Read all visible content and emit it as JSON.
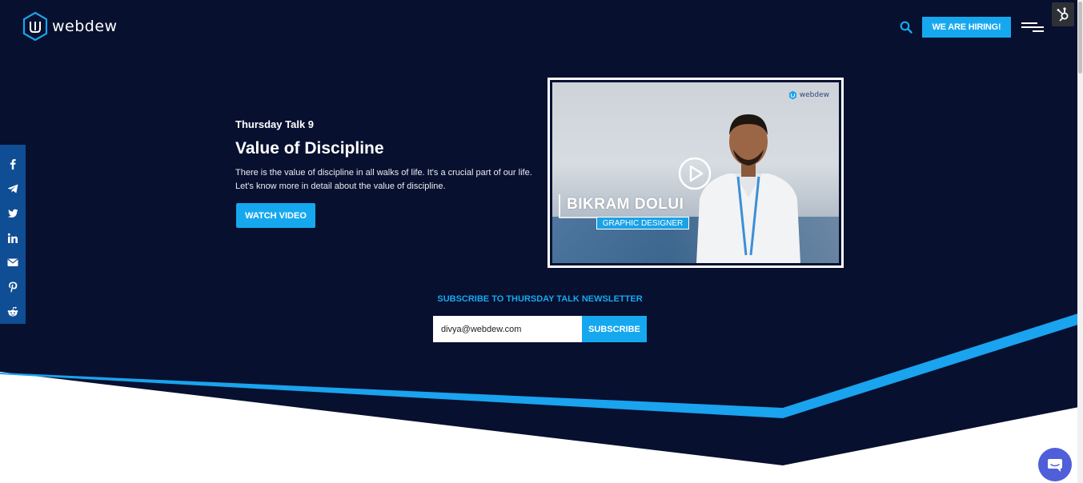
{
  "header": {
    "logo_text": "webdew",
    "hiring_label": "WE ARE HIRING!"
  },
  "colors": {
    "navy": "#07102f",
    "accent": "#16a8ef",
    "social_bar": "#0f4d94",
    "chat": "#4f5fd9"
  },
  "social": [
    {
      "icon": "facebook-icon"
    },
    {
      "icon": "telegram-icon"
    },
    {
      "icon": "twitter-icon"
    },
    {
      "icon": "linkedin-icon"
    },
    {
      "icon": "email-icon"
    },
    {
      "icon": "pinterest-icon"
    },
    {
      "icon": "reddit-icon"
    }
  ],
  "talk": {
    "label": "Thursday Talk 9",
    "title": "Value of Discipline",
    "description": "There is the value of discipline in all walks of life. It's a crucial part of our life. Let's know more in detail about the value of discipline.",
    "button": "WATCH VIDEO"
  },
  "video": {
    "logo_text": "webdew",
    "name": "BIKRAM DOLUI",
    "role": "GRAPHIC DESIGNER"
  },
  "newsletter": {
    "heading": "SUBSCRIBE TO THURSDAY TALK NEWSLETTER",
    "email_value": "divya@webdew.com",
    "button": "SUBSCRIBE"
  }
}
